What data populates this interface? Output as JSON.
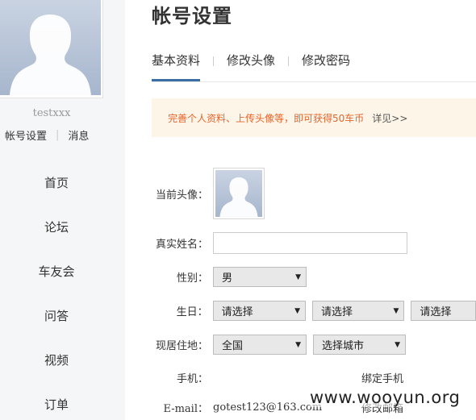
{
  "sidebar": {
    "username": "testxxx",
    "links": [
      "帐号设置",
      "消息"
    ],
    "nav": [
      "首页",
      "论坛",
      "车友会",
      "问答",
      "视频",
      "订单"
    ]
  },
  "main": {
    "title": "帐号设置",
    "tabs": [
      "基本资料",
      "修改头像",
      "修改密码"
    ],
    "notice": {
      "text": "完善个人资料、上传头像等，即可获得50车币",
      "more": "详见>>"
    },
    "form": {
      "avatar_label": "当前头像：",
      "name_label": "真实姓名：",
      "name_value": "",
      "gender_label": "性别：",
      "gender_value": "男",
      "birthday_label": "生日：",
      "birthday_selects": [
        "请选择",
        "请选择",
        "请选择"
      ],
      "residence_label": "现居住地：",
      "residence_selects": [
        "全国",
        "选择城市"
      ],
      "phone_label": "手机：",
      "phone_action": "绑定手机",
      "email_label": "E-mail：",
      "email_value": "gotest123@163.com",
      "email_action": "修改邮箱"
    }
  },
  "watermark": "www.wooyun.org",
  "colors": {
    "accent": "#3a6ea5",
    "notice_text": "#e8632b",
    "notice_bg": "#fdf6e8",
    "sidebar_bg": "#f5f6f7"
  },
  "icons": {
    "avatar": "default-user-silhouette-icon",
    "select_caret": "triangle-down-icon"
  }
}
